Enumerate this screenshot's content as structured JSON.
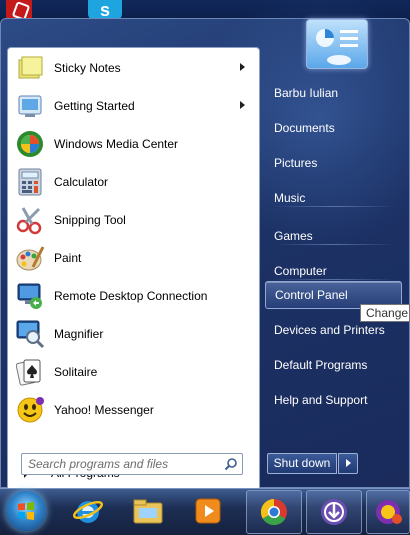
{
  "programs": [
    {
      "label": "Sticky Notes",
      "icon": "sticky-notes-icon",
      "has_submenu": true
    },
    {
      "label": "Getting Started",
      "icon": "getting-started-icon",
      "has_submenu": true
    },
    {
      "label": "Windows Media Center",
      "icon": "media-center-icon",
      "has_submenu": false
    },
    {
      "label": "Calculator",
      "icon": "calculator-icon",
      "has_submenu": false
    },
    {
      "label": "Snipping Tool",
      "icon": "scissors-icon",
      "has_submenu": false
    },
    {
      "label": "Paint",
      "icon": "paint-palette-icon",
      "has_submenu": false
    },
    {
      "label": "Remote Desktop Connection",
      "icon": "remote-desktop-icon",
      "has_submenu": false
    },
    {
      "label": "Magnifier",
      "icon": "magnifier-icon",
      "has_submenu": false
    },
    {
      "label": "Solitaire",
      "icon": "playing-card-icon",
      "has_submenu": false
    },
    {
      "label": "Yahoo! Messenger",
      "icon": "yahoo-messenger-icon",
      "has_submenu": false
    }
  ],
  "all_programs_label": "All Programs",
  "search": {
    "placeholder": "Search programs and files"
  },
  "right_links": [
    {
      "label": "Barbu Iulian"
    },
    {
      "label": "Documents"
    },
    {
      "label": "Pictures"
    },
    {
      "label": "Music"
    },
    {
      "label": "Games"
    },
    {
      "label": "Computer"
    },
    {
      "label": "Control Panel"
    },
    {
      "label": "Devices and Printers"
    },
    {
      "label": "Default Programs"
    },
    {
      "label": "Help and Support"
    }
  ],
  "tooltip": "Change",
  "shutdown_label": "Shut down",
  "taskbar_icons": [
    "internet-explorer-icon",
    "file-explorer-icon",
    "media-player-icon",
    "chrome-icon",
    "torrent-client-icon",
    "yahoo-messenger-icon"
  ],
  "colors": {
    "accent": "#1c3266",
    "pane": "#ffffff"
  }
}
